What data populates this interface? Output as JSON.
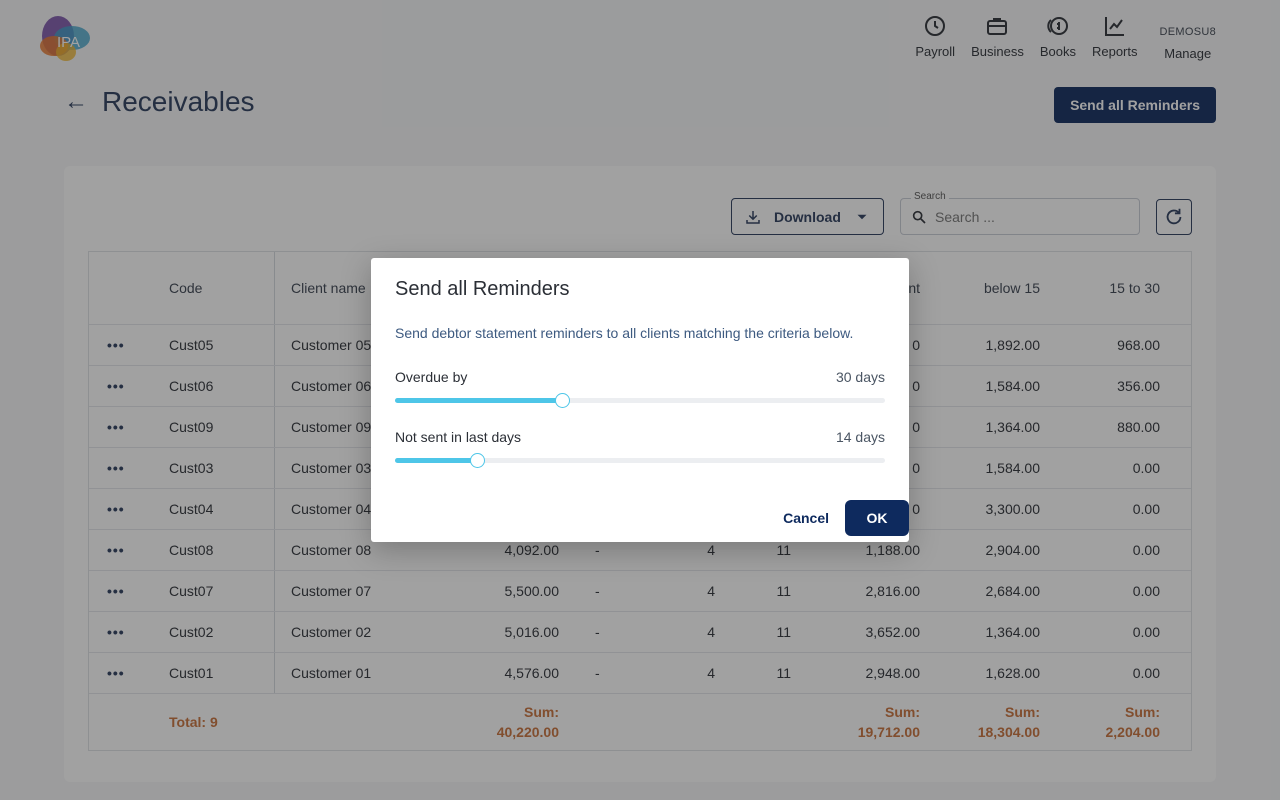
{
  "header": {
    "logo_text": "IPA",
    "nav": [
      {
        "label": "Payroll",
        "icon": "clock-icon"
      },
      {
        "label": "Business",
        "icon": "briefcase-icon"
      },
      {
        "label": "Books",
        "icon": "coins-icon"
      },
      {
        "label": "Reports",
        "icon": "chart-line-icon"
      }
    ],
    "user": {
      "name": "DEMOSU8",
      "label": "Manage"
    }
  },
  "page": {
    "title": "Receivables",
    "send_all_label": "Send all Reminders"
  },
  "toolbar": {
    "download_label": "Download",
    "search_legend": "Search",
    "search_placeholder": "Search ..."
  },
  "table": {
    "headers": {
      "code": "Code",
      "client_name": "Client name",
      "amount_partial": "nt",
      "below15": "below 15",
      "15to30": "15 to 30"
    },
    "rows": [
      {
        "code": "Cust05",
        "name": "Customer 05",
        "amount": "",
        "dash": "",
        "n1": "",
        "n2": "",
        "amt2": "0",
        "below15": "1,892.00",
        "r1530": "968.00"
      },
      {
        "code": "Cust06",
        "name": "Customer 06",
        "amount": "",
        "dash": "",
        "n1": "",
        "n2": "",
        "amt2": "0",
        "below15": "1,584.00",
        "r1530": "356.00"
      },
      {
        "code": "Cust09",
        "name": "Customer 09",
        "amount": "",
        "dash": "",
        "n1": "",
        "n2": "",
        "amt2": "0",
        "below15": "1,364.00",
        "r1530": "880.00"
      },
      {
        "code": "Cust03",
        "name": "Customer 03",
        "amount": "",
        "dash": "",
        "n1": "",
        "n2": "",
        "amt2": "0",
        "below15": "1,584.00",
        "r1530": "0.00"
      },
      {
        "code": "Cust04",
        "name": "Customer 04",
        "amount": "",
        "dash": "",
        "n1": "",
        "n2": "",
        "amt2": "0",
        "below15": "3,300.00",
        "r1530": "0.00"
      },
      {
        "code": "Cust08",
        "name": "Customer 08",
        "amount": "4,092.00",
        "dash": "-",
        "n1": "4",
        "n2": "11",
        "amt2": "1,188.00",
        "below15": "2,904.00",
        "r1530": "0.00"
      },
      {
        "code": "Cust07",
        "name": "Customer 07",
        "amount": "5,500.00",
        "dash": "-",
        "n1": "4",
        "n2": "11",
        "amt2": "2,816.00",
        "below15": "2,684.00",
        "r1530": "0.00"
      },
      {
        "code": "Cust02",
        "name": "Customer 02",
        "amount": "5,016.00",
        "dash": "-",
        "n1": "4",
        "n2": "11",
        "amt2": "3,652.00",
        "below15": "1,364.00",
        "r1530": "0.00"
      },
      {
        "code": "Cust01",
        "name": "Customer 01",
        "amount": "4,576.00",
        "dash": "-",
        "n1": "4",
        "n2": "11",
        "amt2": "2,948.00",
        "below15": "1,628.00",
        "r1530": "0.00"
      }
    ],
    "footer": {
      "total_label": "Total: 9",
      "sum_label": "Sum:",
      "amount_sum": "40,220.00",
      "amt2_sum": "19,712.00",
      "below15_sum": "18,304.00",
      "r1530_sum": "2,204.00"
    }
  },
  "modal": {
    "title": "Send all Reminders",
    "description": "Send debtor statement reminders to all clients matching the criteria below.",
    "sliders": [
      {
        "label": "Overdue by",
        "value_text": "30 days",
        "fraction": 0.34
      },
      {
        "label": "Not sent in last days",
        "value_text": "14 days",
        "fraction": 0.167
      }
    ],
    "cancel_label": "Cancel",
    "ok_label": "OK"
  },
  "colors": {
    "primary": "#0e2a5e",
    "accent": "#4ec6e8",
    "sum_text": "#c9703a"
  }
}
